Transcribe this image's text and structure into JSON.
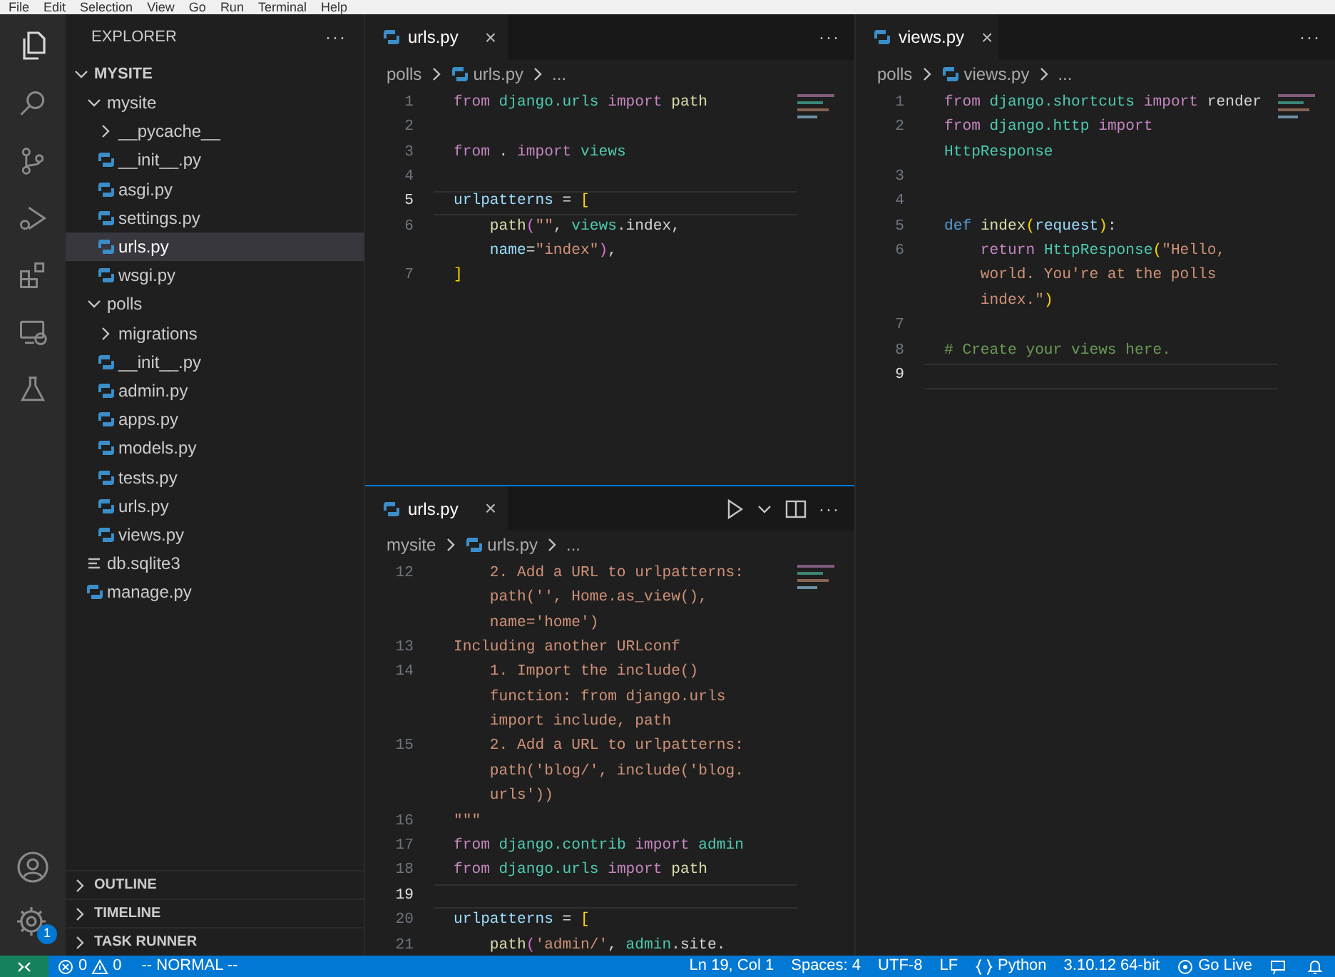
{
  "menu_bar": [
    "File",
    "Edit",
    "Selection",
    "View",
    "Go",
    "Run",
    "Terminal",
    "Help"
  ],
  "activity_bar": {
    "badge": "1"
  },
  "sidebar": {
    "title": "EXPLORER",
    "more": "···",
    "tree": {
      "label": "MYSITE",
      "expanded": true,
      "children": [
        {
          "label": "mysite",
          "kind": "folder",
          "expanded": true,
          "selected": false,
          "children": [
            {
              "label": "__pycache__",
              "kind": "folder",
              "expanded": false,
              "selected": false
            },
            {
              "label": "__init__.py",
              "kind": "python",
              "selected": false
            },
            {
              "label": "asgi.py",
              "kind": "python",
              "selected": false
            },
            {
              "label": "settings.py",
              "kind": "python",
              "selected": false
            },
            {
              "label": "urls.py",
              "kind": "python",
              "selected": true
            },
            {
              "label": "wsgi.py",
              "kind": "python",
              "selected": false
            }
          ]
        },
        {
          "label": "polls",
          "kind": "folder",
          "expanded": true,
          "selected": false,
          "children": [
            {
              "label": "migrations",
              "kind": "folder",
              "expanded": false,
              "selected": false
            },
            {
              "label": "__init__.py",
              "kind": "python",
              "selected": false
            },
            {
              "label": "admin.py",
              "kind": "python",
              "selected": false
            },
            {
              "label": "apps.py",
              "kind": "python",
              "selected": false
            },
            {
              "label": "models.py",
              "kind": "python",
              "selected": false
            },
            {
              "label": "tests.py",
              "kind": "python",
              "selected": false
            },
            {
              "label": "urls.py",
              "kind": "python",
              "selected": false
            },
            {
              "label": "views.py",
              "kind": "python",
              "selected": false
            }
          ]
        },
        {
          "label": "db.sqlite3",
          "kind": "database",
          "selected": false
        },
        {
          "label": "manage.py",
          "kind": "python",
          "selected": false
        }
      ]
    },
    "sections": [
      {
        "label": "OUTLINE",
        "expanded": false
      },
      {
        "label": "TIMELINE",
        "expanded": false
      },
      {
        "label": "TASK RUNNER",
        "expanded": false
      }
    ]
  },
  "editors": [
    {
      "tab": "urls.py",
      "close": "×",
      "more": "···",
      "focused": false,
      "breadcrumb": [
        "polls",
        "urls.py",
        "..."
      ],
      "actions": false,
      "rows": [
        {
          "num": "1",
          "current": false,
          "tokens": [
            {
              "kind": "keyword",
              "text": "from "
            },
            {
              "kind": "module",
              "text": "django.urls "
            },
            {
              "kind": "keyword",
              "text": "import "
            },
            {
              "kind": "function",
              "text": "path"
            }
          ]
        },
        {
          "num": "2",
          "current": false,
          "tokens": []
        },
        {
          "num": "3",
          "current": false,
          "tokens": [
            {
              "kind": "keyword",
              "text": "from "
            },
            {
              "kind": "plain",
              "text": ". "
            },
            {
              "kind": "keyword",
              "text": "import "
            },
            {
              "kind": "module",
              "text": "views"
            }
          ]
        },
        {
          "num": "4",
          "current": false,
          "tokens": []
        },
        {
          "num": "5",
          "current": true,
          "tokens": [
            {
              "kind": "variable",
              "text": "urlpatterns"
            },
            {
              "kind": "plain",
              "text": " = "
            },
            {
              "kind": "bracket",
              "text": "["
            }
          ]
        },
        {
          "num": "6",
          "current": false,
          "tokens": [
            {
              "kind": "function",
              "text": "    path"
            },
            {
              "kind": "bracket2",
              "text": "("
            },
            {
              "kind": "string",
              "text": "\"\""
            },
            {
              "kind": "plain",
              "text": ", "
            },
            {
              "kind": "module",
              "text": "views"
            },
            {
              "kind": "plain",
              "text": ".index,"
            }
          ]
        },
        {
          "tokens": [
            {
              "kind": "variable",
              "text": "    name"
            },
            {
              "kind": "plain",
              "text": "="
            },
            {
              "kind": "string",
              "text": "\"index\""
            },
            {
              "kind": "bracket2",
              "text": ")"
            },
            {
              "kind": "plain",
              "text": ","
            }
          ]
        },
        {
          "num": "7",
          "current": false,
          "tokens": [
            {
              "kind": "bracket",
              "text": "]"
            }
          ]
        }
      ]
    },
    {
      "tab": "urls.py",
      "close": "×",
      "more": "···",
      "focused": true,
      "breadcrumb": [
        "mysite",
        "urls.py",
        "..."
      ],
      "actions": true,
      "rows": [
        {
          "num": "12",
          "current": false,
          "tokens": [
            {
              "kind": "string",
              "text": "    2. Add a URL to urlpatterns:"
            }
          ]
        },
        {
          "tokens": [
            {
              "kind": "string",
              "text": "    path('', Home.as_view(),"
            }
          ]
        },
        {
          "tokens": [
            {
              "kind": "string",
              "text": "    name='home')"
            }
          ]
        },
        {
          "num": "13",
          "current": false,
          "tokens": [
            {
              "kind": "string",
              "text": "Including another URLconf"
            }
          ]
        },
        {
          "num": "14",
          "current": false,
          "tokens": [
            {
              "kind": "string",
              "text": "    1. Import the include()"
            }
          ]
        },
        {
          "tokens": [
            {
              "kind": "string",
              "text": "    function: from django.urls"
            }
          ]
        },
        {
          "tokens": [
            {
              "kind": "string",
              "text": "    import include, path"
            }
          ]
        },
        {
          "num": "15",
          "current": false,
          "tokens": [
            {
              "kind": "string",
              "text": "    2. Add a URL to urlpatterns:"
            }
          ]
        },
        {
          "tokens": [
            {
              "kind": "string",
              "text": "    path('blog/', include('blog."
            }
          ]
        },
        {
          "tokens": [
            {
              "kind": "string",
              "text": "    urls'))"
            }
          ]
        },
        {
          "num": "16",
          "current": false,
          "tokens": [
            {
              "kind": "string",
              "text": "\"\"\""
            }
          ]
        },
        {
          "num": "17",
          "current": false,
          "tokens": [
            {
              "kind": "keyword",
              "text": "from "
            },
            {
              "kind": "module",
              "text": "django.contrib "
            },
            {
              "kind": "keyword",
              "text": "import "
            },
            {
              "kind": "module",
              "text": "admin"
            }
          ]
        },
        {
          "num": "18",
          "current": false,
          "tokens": [
            {
              "kind": "keyword",
              "text": "from "
            },
            {
              "kind": "module",
              "text": "django.urls "
            },
            {
              "kind": "keyword",
              "text": "import "
            },
            {
              "kind": "function",
              "text": "path"
            }
          ]
        },
        {
          "num": "19",
          "current": true,
          "tokens": []
        },
        {
          "num": "20",
          "current": false,
          "tokens": [
            {
              "kind": "variable",
              "text": "urlpatterns"
            },
            {
              "kind": "plain",
              "text": " = "
            },
            {
              "kind": "bracket",
              "text": "["
            }
          ]
        },
        {
          "num": "21",
          "current": false,
          "tokens": [
            {
              "kind": "function",
              "text": "    path"
            },
            {
              "kind": "bracket2",
              "text": "("
            },
            {
              "kind": "string",
              "text": "'admin/'"
            },
            {
              "kind": "plain",
              "text": ", "
            },
            {
              "kind": "module",
              "text": "admin"
            },
            {
              "kind": "plain",
              "text": ".site."
            }
          ]
        }
      ]
    },
    {
      "tab": "views.py",
      "close": "×",
      "more": "···",
      "focused": false,
      "breadcrumb": [
        "polls",
        "views.py",
        "..."
      ],
      "actions": false,
      "rows": [
        {
          "num": "1",
          "current": false,
          "tokens": [
            {
              "kind": "keyword",
              "text": "from "
            },
            {
              "kind": "module",
              "text": "django.shortcuts "
            },
            {
              "kind": "keyword",
              "text": "import "
            },
            {
              "kind": "plain",
              "text": "render"
            }
          ]
        },
        {
          "num": "2",
          "current": false,
          "tokens": [
            {
              "kind": "keyword",
              "text": "from "
            },
            {
              "kind": "module",
              "text": "django.http "
            },
            {
              "kind": "keyword",
              "text": "import"
            }
          ]
        },
        {
          "tokens": [
            {
              "kind": "module",
              "text": "HttpResponse"
            }
          ]
        },
        {
          "num": "3",
          "current": false,
          "tokens": []
        },
        {
          "num": "4",
          "current": false,
          "tokens": []
        },
        {
          "num": "5",
          "current": false,
          "tokens": [
            {
              "kind": "storage",
              "text": "def "
            },
            {
              "kind": "function",
              "text": "index"
            },
            {
              "kind": "bracket",
              "text": "("
            },
            {
              "kind": "variable",
              "text": "request"
            },
            {
              "kind": "bracket",
              "text": ")"
            },
            {
              "kind": "plain",
              "text": ":"
            }
          ]
        },
        {
          "num": "6",
          "current": false,
          "tokens": [
            {
              "kind": "keyword",
              "text": "    return "
            },
            {
              "kind": "module",
              "text": "HttpResponse"
            },
            {
              "kind": "bracket",
              "text": "("
            },
            {
              "kind": "string",
              "text": "\"Hello,"
            }
          ]
        },
        {
          "tokens": [
            {
              "kind": "string",
              "text": "    world. You're at the polls"
            }
          ]
        },
        {
          "tokens": [
            {
              "kind": "string",
              "text": "    index.\""
            },
            {
              "kind": "bracket",
              "text": ")"
            }
          ]
        },
        {
          "num": "7",
          "current": false,
          "tokens": []
        },
        {
          "num": "8",
          "current": false,
          "tokens": [
            {
              "kind": "comment",
              "text": "# Create your views here."
            }
          ]
        },
        {
          "num": "9",
          "current": true,
          "tokens": []
        }
      ]
    }
  ],
  "status_bar": {
    "errors": "0",
    "warnings": "0",
    "mode": "-- NORMAL --",
    "position": "Ln 19, Col 1",
    "spaces": "Spaces: 4",
    "encoding": "UTF-8",
    "eol": "LF",
    "language": "Python",
    "interpreter": "3.10.12 64-bit",
    "live": "Go Live"
  }
}
